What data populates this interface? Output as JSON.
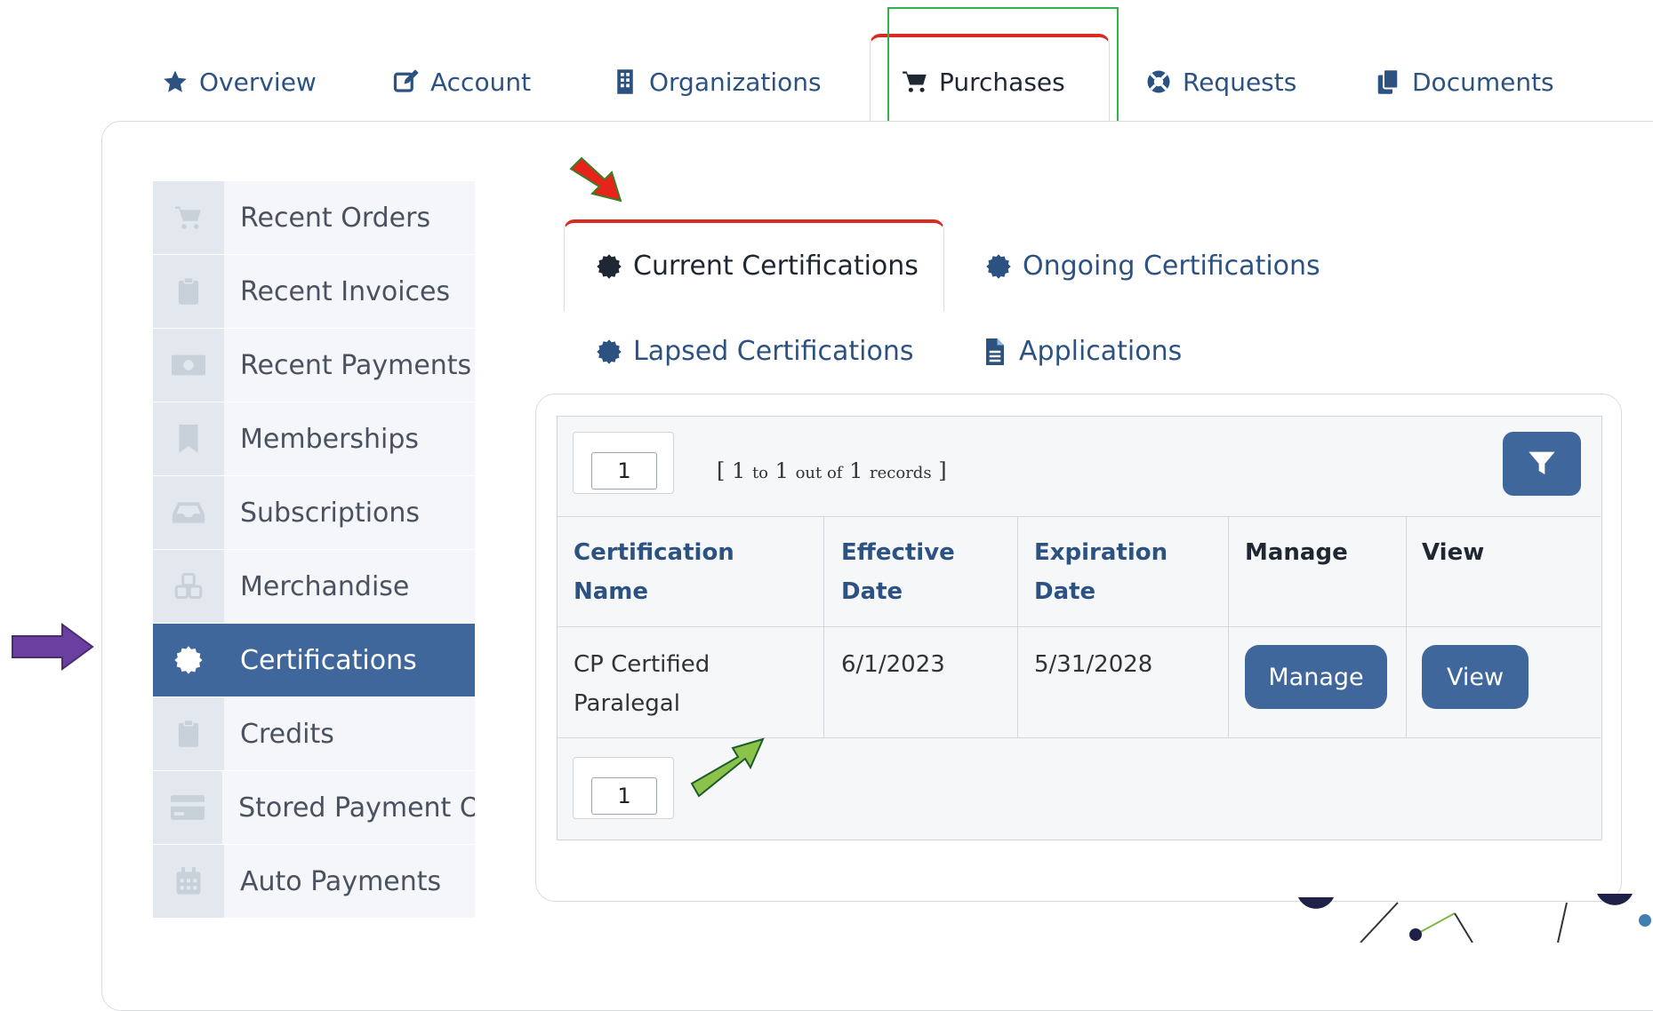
{
  "top_tabs": [
    {
      "label": "Overview",
      "icon": "star-icon"
    },
    {
      "label": "Account",
      "icon": "edit-icon"
    },
    {
      "label": "Organizations",
      "icon": "building-icon"
    },
    {
      "label": "Purchases",
      "icon": "cart-icon",
      "active": true
    },
    {
      "label": "Requests",
      "icon": "lifering-icon"
    },
    {
      "label": "Documents",
      "icon": "documents-icon"
    }
  ],
  "side_nav": [
    {
      "label": "Recent Orders",
      "icon": "cart-icon"
    },
    {
      "label": "Recent Invoices",
      "icon": "clipboard-icon"
    },
    {
      "label": "Recent Payments",
      "icon": "money-icon"
    },
    {
      "label": "Memberships",
      "icon": "bookmark-icon"
    },
    {
      "label": "Subscriptions",
      "icon": "inbox-icon"
    },
    {
      "label": "Merchandise",
      "icon": "cubes-icon"
    },
    {
      "label": "Certifications",
      "icon": "certificate-icon",
      "active": true
    },
    {
      "label": "Credits",
      "icon": "clipboard-icon"
    },
    {
      "label": "Stored Payment O",
      "icon": "credit-card-icon"
    },
    {
      "label": "Auto Payments",
      "icon": "calendar-icon"
    }
  ],
  "cert_tabs": [
    {
      "label": "Current Certifications",
      "icon": "certificate-icon",
      "active": true
    },
    {
      "label": "Ongoing Certifications",
      "icon": "certificate-icon"
    },
    {
      "label": "Lapsed Certifications",
      "icon": "certificate-icon"
    },
    {
      "label": "Applications",
      "icon": "file-icon"
    }
  ],
  "pager": {
    "page_top": "1",
    "page_bottom": "1",
    "records_open": "[",
    "records_from": "1",
    "records_to_word": "to",
    "records_to": "1",
    "records_of_word": "out of",
    "records_total": "1",
    "records_word": "records",
    "records_close": "]"
  },
  "table": {
    "headers": {
      "name": "Certification Name",
      "effective": "Effective Date",
      "expiration": "Expiration Date",
      "manage": "Manage",
      "view": "View"
    },
    "rows": [
      {
        "name": "CP Certified Paralegal",
        "effective": "6/1/2023",
        "expiration": "5/31/2028",
        "manage_label": "Manage",
        "view_label": "View"
      }
    ]
  },
  "colors": {
    "accent": "#3f679b",
    "active_tab_border": "#d92b22",
    "highlight_box": "#2fb24c",
    "arrow_red": "#e8231c",
    "arrow_purple": "#6b3fa0",
    "arrow_green": "#8bc34a"
  }
}
